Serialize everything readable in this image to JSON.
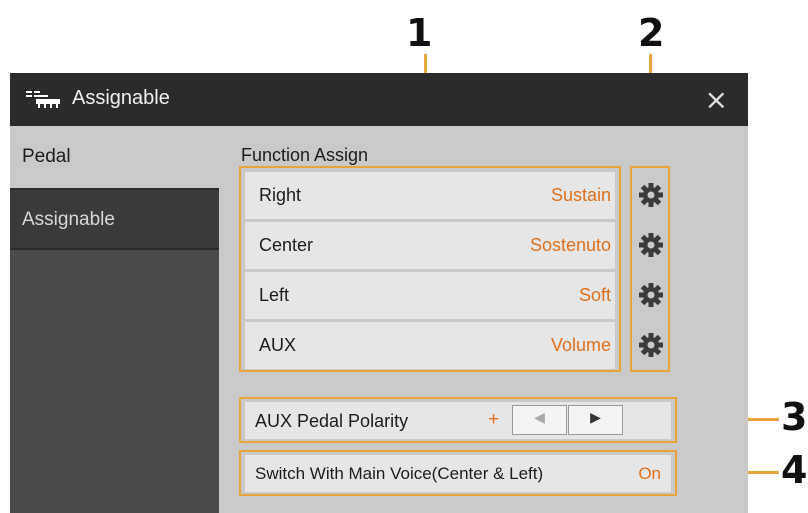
{
  "callouts": {
    "c1": "1",
    "c2": "2",
    "c3": "3",
    "c4": "4"
  },
  "window": {
    "title": "Assignable",
    "close_label": "×"
  },
  "sidebar": {
    "tabs": [
      {
        "label": "Pedal",
        "active": true
      },
      {
        "label": "Assignable",
        "active": false
      }
    ]
  },
  "function_assign": {
    "title": "Function Assign",
    "rows": [
      {
        "label": "Right",
        "value": "Sustain"
      },
      {
        "label": "Center",
        "value": "Sostenuto"
      },
      {
        "label": "Left",
        "value": "Soft"
      },
      {
        "label": "AUX",
        "value": "Volume"
      }
    ]
  },
  "aux_polarity": {
    "label": "AUX Pedal Polarity",
    "value": "+",
    "left_arrow": "◀",
    "right_arrow": "▶"
  },
  "switch_main_voice": {
    "label": "Switch With Main Voice(Center & Left)",
    "value": "On"
  },
  "colors": {
    "accent": "#e8a43a",
    "value_text": "#e0701a",
    "titlebar": "#2b2b2b",
    "panel": "#c9c9c9"
  },
  "icons": {
    "title": "pedal-icon",
    "settings": "gear-icon"
  }
}
